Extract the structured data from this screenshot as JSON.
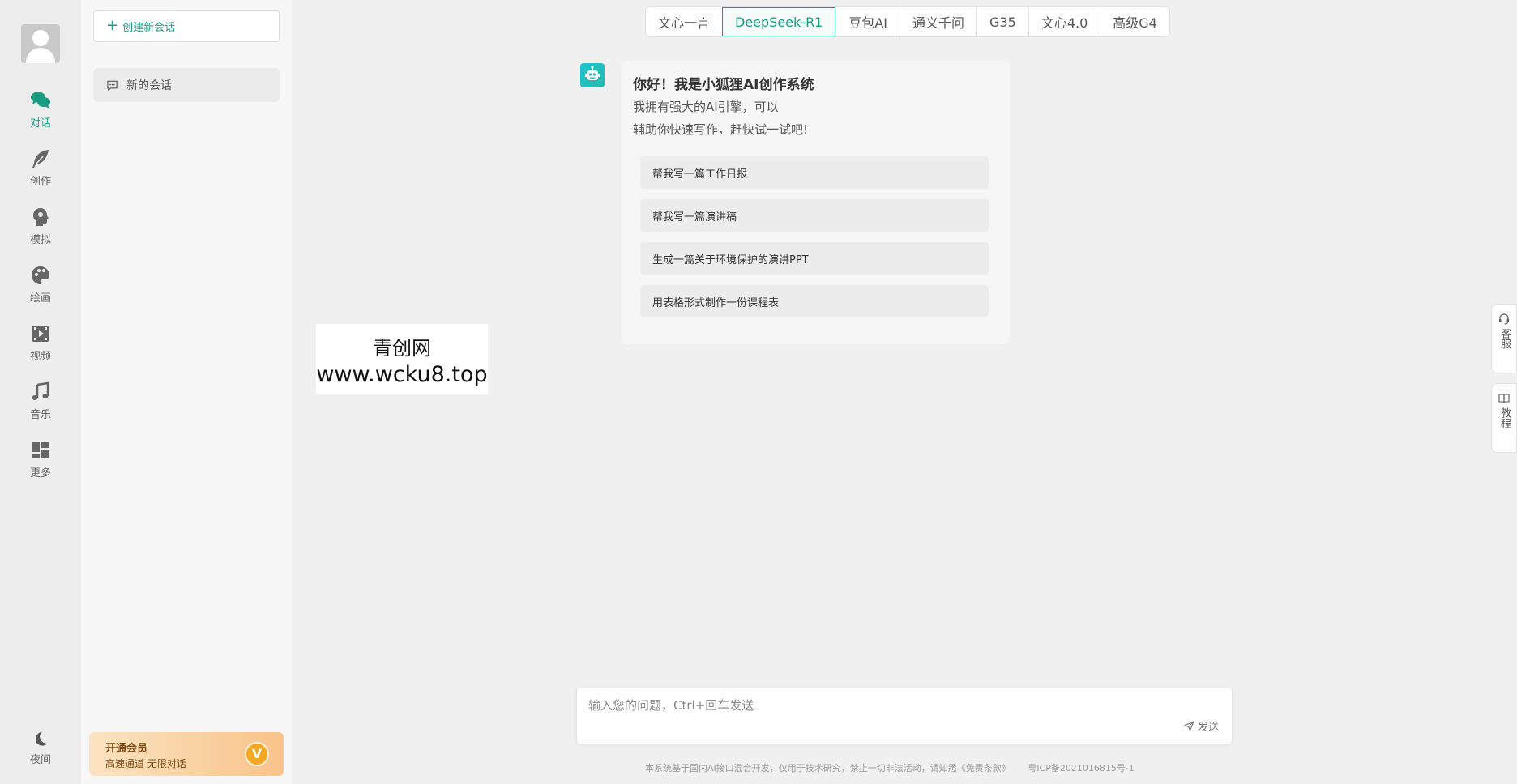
{
  "colors": {
    "accent": "#1a9c82",
    "vip_start": "#fbe3c2",
    "vip_end": "#f8c48a"
  },
  "rail": {
    "items": [
      {
        "label": "对话",
        "icon": "chat-icon"
      },
      {
        "label": "创作",
        "icon": "feather-icon"
      },
      {
        "label": "模拟",
        "icon": "head-icon"
      },
      {
        "label": "绘画",
        "icon": "palette-icon"
      },
      {
        "label": "视频",
        "icon": "video-icon"
      },
      {
        "label": "音乐",
        "icon": "music-icon"
      },
      {
        "label": "更多",
        "icon": "dashboard-icon"
      }
    ],
    "night_label": "夜间"
  },
  "sidebar": {
    "new_chat_label": "创建新会话",
    "conversations": [
      {
        "title": "新的会话"
      }
    ],
    "vip": {
      "title": "开通会员",
      "subtitle": "高速通道 无限对话",
      "badge": "V"
    }
  },
  "watermark": {
    "line1": "青创网",
    "line2": "www.wcku8.top"
  },
  "tabs": [
    {
      "label": "文心一言"
    },
    {
      "label": "DeepSeek-R1",
      "active": true
    },
    {
      "label": "豆包AI"
    },
    {
      "label": "通义千问"
    },
    {
      "label": "G35"
    },
    {
      "label": "文心4.0"
    },
    {
      "label": "高级G4"
    }
  ],
  "welcome": {
    "title": "你好！我是小狐狸AI创作系统",
    "desc_line1": "我拥有强大的AI引擎，可以",
    "desc_line2": "辅助你快速写作，赶快试一试吧!",
    "suggestions": [
      "帮我写一篇工作日报",
      "帮我写一篇演讲稿",
      "生成一篇关于环境保护的演讲PPT",
      "用表格形式制作一份课程表"
    ]
  },
  "input": {
    "placeholder": "输入您的问题，Ctrl+回车发送",
    "value": "",
    "send_label": "发送"
  },
  "footer": {
    "disclaimer": "本系统基于国内AI接口混合开发，仅用于技术研究，禁止一切非法活动，请知悉《免责条款》",
    "icp": "粤ICP备2021016815号-1"
  },
  "floating": {
    "service_label": "客服",
    "tutorial_label": "教程"
  }
}
